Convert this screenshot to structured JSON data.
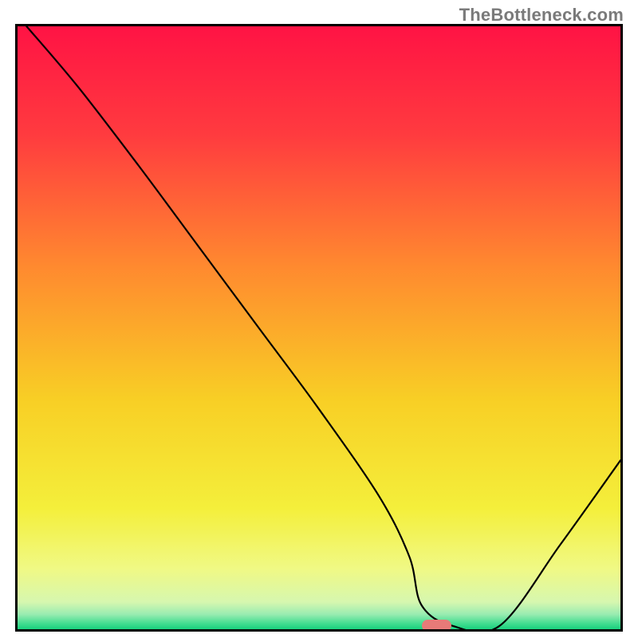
{
  "watermark": "TheBottleneck.com",
  "chart_data": {
    "type": "line",
    "title": "",
    "xlabel": "",
    "ylabel": "",
    "xlim": [
      0,
      100
    ],
    "ylim": [
      0,
      100
    ],
    "grid": false,
    "legend": false,
    "series": [
      {
        "name": "curve",
        "color": "#000000",
        "x": [
          1.5,
          10,
          20,
          30,
          40,
          50,
          60,
          65,
          67,
          72,
          80,
          90,
          100
        ],
        "y": [
          100,
          90,
          77,
          63.5,
          50,
          36.5,
          22,
          12,
          4,
          0.6,
          0.6,
          14,
          28
        ]
      }
    ],
    "marker": {
      "color": "#e77a78",
      "shape": "capsule",
      "x_range": [
        67,
        72
      ],
      "y": 0.6
    },
    "background_gradient": {
      "type": "vertical",
      "stops": [
        {
          "pos": 0.0,
          "color": "#ff1344"
        },
        {
          "pos": 0.18,
          "color": "#ff3b3f"
        },
        {
          "pos": 0.4,
          "color": "#ff8a2f"
        },
        {
          "pos": 0.62,
          "color": "#f8cf25"
        },
        {
          "pos": 0.8,
          "color": "#f4ef3b"
        },
        {
          "pos": 0.9,
          "color": "#f0f985"
        },
        {
          "pos": 0.955,
          "color": "#d6f7af"
        },
        {
          "pos": 0.975,
          "color": "#9aecb1"
        },
        {
          "pos": 0.99,
          "color": "#45dd91"
        },
        {
          "pos": 1.0,
          "color": "#18d07d"
        }
      ]
    }
  }
}
